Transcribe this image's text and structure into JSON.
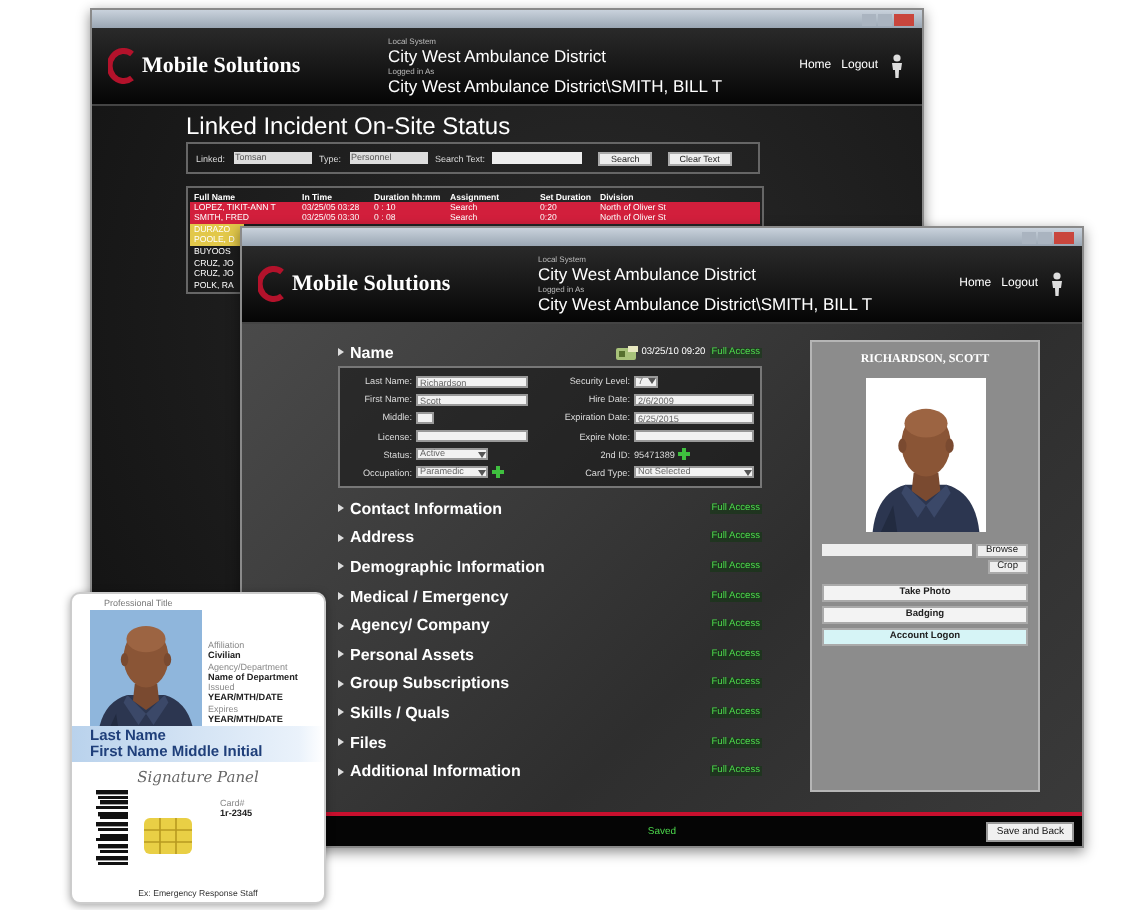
{
  "back_window": {
    "header": {
      "system_label": "Local System",
      "system": "City West Ambulance District",
      "login_label": "Logged in As",
      "login": "City West Ambulance District\\SMITH, BILL T",
      "links": [
        "Home",
        "Logout"
      ]
    },
    "logo": "Mobile Solutions",
    "page_title": "Linked Incident On-Site Status",
    "filters": [
      {
        "label": "Linked:",
        "value": "Tomsan",
        "kind": "select"
      },
      {
        "label": "Type:",
        "value": "Personnel",
        "kind": "select"
      },
      {
        "label": "Search Text:",
        "kind": "text"
      }
    ],
    "filter_buttons": [
      "Search",
      "Clear Text"
    ],
    "table": {
      "columns": [
        "Full Name",
        "In Time",
        "Duration hh:mm",
        "Assignment",
        "Set Duration",
        "Division"
      ],
      "rows": [
        {
          "cells": [
            "LOPEZ, TIKIT-ANN T",
            "03/25/05 03:28",
            "0 : 10",
            "Search",
            "0:20",
            "North of Oliver St"
          ],
          "color": "#d21f3c"
        },
        {
          "cells": [
            "SMITH, FRED",
            "03/25/05 03:30",
            "0 : 08",
            "Search",
            "0:20",
            "North of Oliver St"
          ],
          "color": "#d21f3c"
        },
        {
          "cells": [
            "DURAZO"
          ],
          "color": "#e2c84a"
        },
        {
          "cells": [
            "POOLE, D"
          ],
          "color": "#e2c84a"
        },
        {
          "cells": [
            "BUYOOS"
          ]
        },
        {
          "cells": [
            "CRUZ, JO"
          ]
        },
        {
          "cells": [
            "CRUZ, JO"
          ]
        },
        {
          "cells": [
            "POLK, RA"
          ]
        }
      ]
    }
  },
  "front_window": {
    "header": {
      "system_label": "Local System",
      "system": "City West Ambulance District",
      "login_label": "Logged in As",
      "login": "City West Ambulance District\\SMITH, BILL T",
      "links": [
        "Home",
        "Logout"
      ]
    },
    "logo": "Mobile Solutions",
    "name_section": {
      "title": "Name",
      "timestamp": "03/25/10 09:20",
      "access": "Full Access",
      "fields_left": [
        {
          "label": "Last Name:",
          "value": "Richardson",
          "kind": "text",
          "action_icon": false
        },
        {
          "label": "First Name:",
          "value": "Scott",
          "kind": "text",
          "action_icon": false
        },
        {
          "label": "Middle:",
          "kind": "short",
          "action_icon": false
        },
        {
          "label": "License:",
          "kind": "text",
          "action_icon": false
        },
        {
          "label": "Status:",
          "value": "Active",
          "kind": "select",
          "action_icon": false
        },
        {
          "label": "Occupation:",
          "value": "Paramedic",
          "kind": "select",
          "action_icon": true
        }
      ],
      "fields_right": [
        {
          "label": "Security Level:",
          "value": "7",
          "kind": "select",
          "action_icon": false
        },
        {
          "label": "Hire Date:",
          "value": "2/6/2009",
          "kind": "text",
          "action_icon": false
        },
        {
          "label": "Expiration Date:",
          "value": "6/25/2015",
          "kind": "text",
          "action_icon": false
        },
        {
          "label": "Expire Note:",
          "kind": "text",
          "action_icon": false
        },
        {
          "label": "2nd ID:",
          "value": "95471389",
          "kind": "plain",
          "action_icon": true
        },
        {
          "label": "Card Type:",
          "value": "Not Selected",
          "kind": "select",
          "action_icon": false
        }
      ]
    },
    "sections": [
      {
        "title": "Contact Information",
        "access": "Full Access"
      },
      {
        "title": "Address",
        "access": "Full Access"
      },
      {
        "title": "Demographic Information",
        "access": "Full Access"
      },
      {
        "title": "Medical / Emergency",
        "access": "Full Access"
      },
      {
        "title": "Agency/ Company",
        "access": "Full Access"
      },
      {
        "title": "Personal Assets",
        "access": "Full Access"
      },
      {
        "title": "Group Subscriptions",
        "access": "Full Access"
      },
      {
        "title": "Skills / Quals",
        "access": "Full Access"
      },
      {
        "title": "Files",
        "access": "Full Access"
      },
      {
        "title": "Additional Information",
        "access": "Full Access"
      }
    ],
    "photo_panel": {
      "name": "RICHARDSON, SCOTT",
      "browse": "Browse",
      "crop": "Crop",
      "buttons": [
        {
          "label": "Take Photo",
          "highlighted": false
        },
        {
          "label": "Badging",
          "highlighted": false
        },
        {
          "label": "Account Logon",
          "highlighted": true
        }
      ]
    },
    "status": "Saved",
    "save_button": "Save and Back"
  },
  "id_card": {
    "title_label": "Professional Title",
    "fields": [
      {
        "label": "Affiliation",
        "value": "Civilian"
      },
      {
        "label": "Agency/Department",
        "value": "Name of Department"
      },
      {
        "label": "Issued",
        "value": "YEAR/MTH/DATE"
      },
      {
        "label": "Expires",
        "value": "YEAR/MTH/DATE"
      }
    ],
    "last_name": "Last Name",
    "first_name": "First Name Middle Initial",
    "signature": "Signature Panel",
    "card_no_label": "Card#",
    "card_no": "1r-2345",
    "footer": "Ex: Emergency Response Staff"
  }
}
